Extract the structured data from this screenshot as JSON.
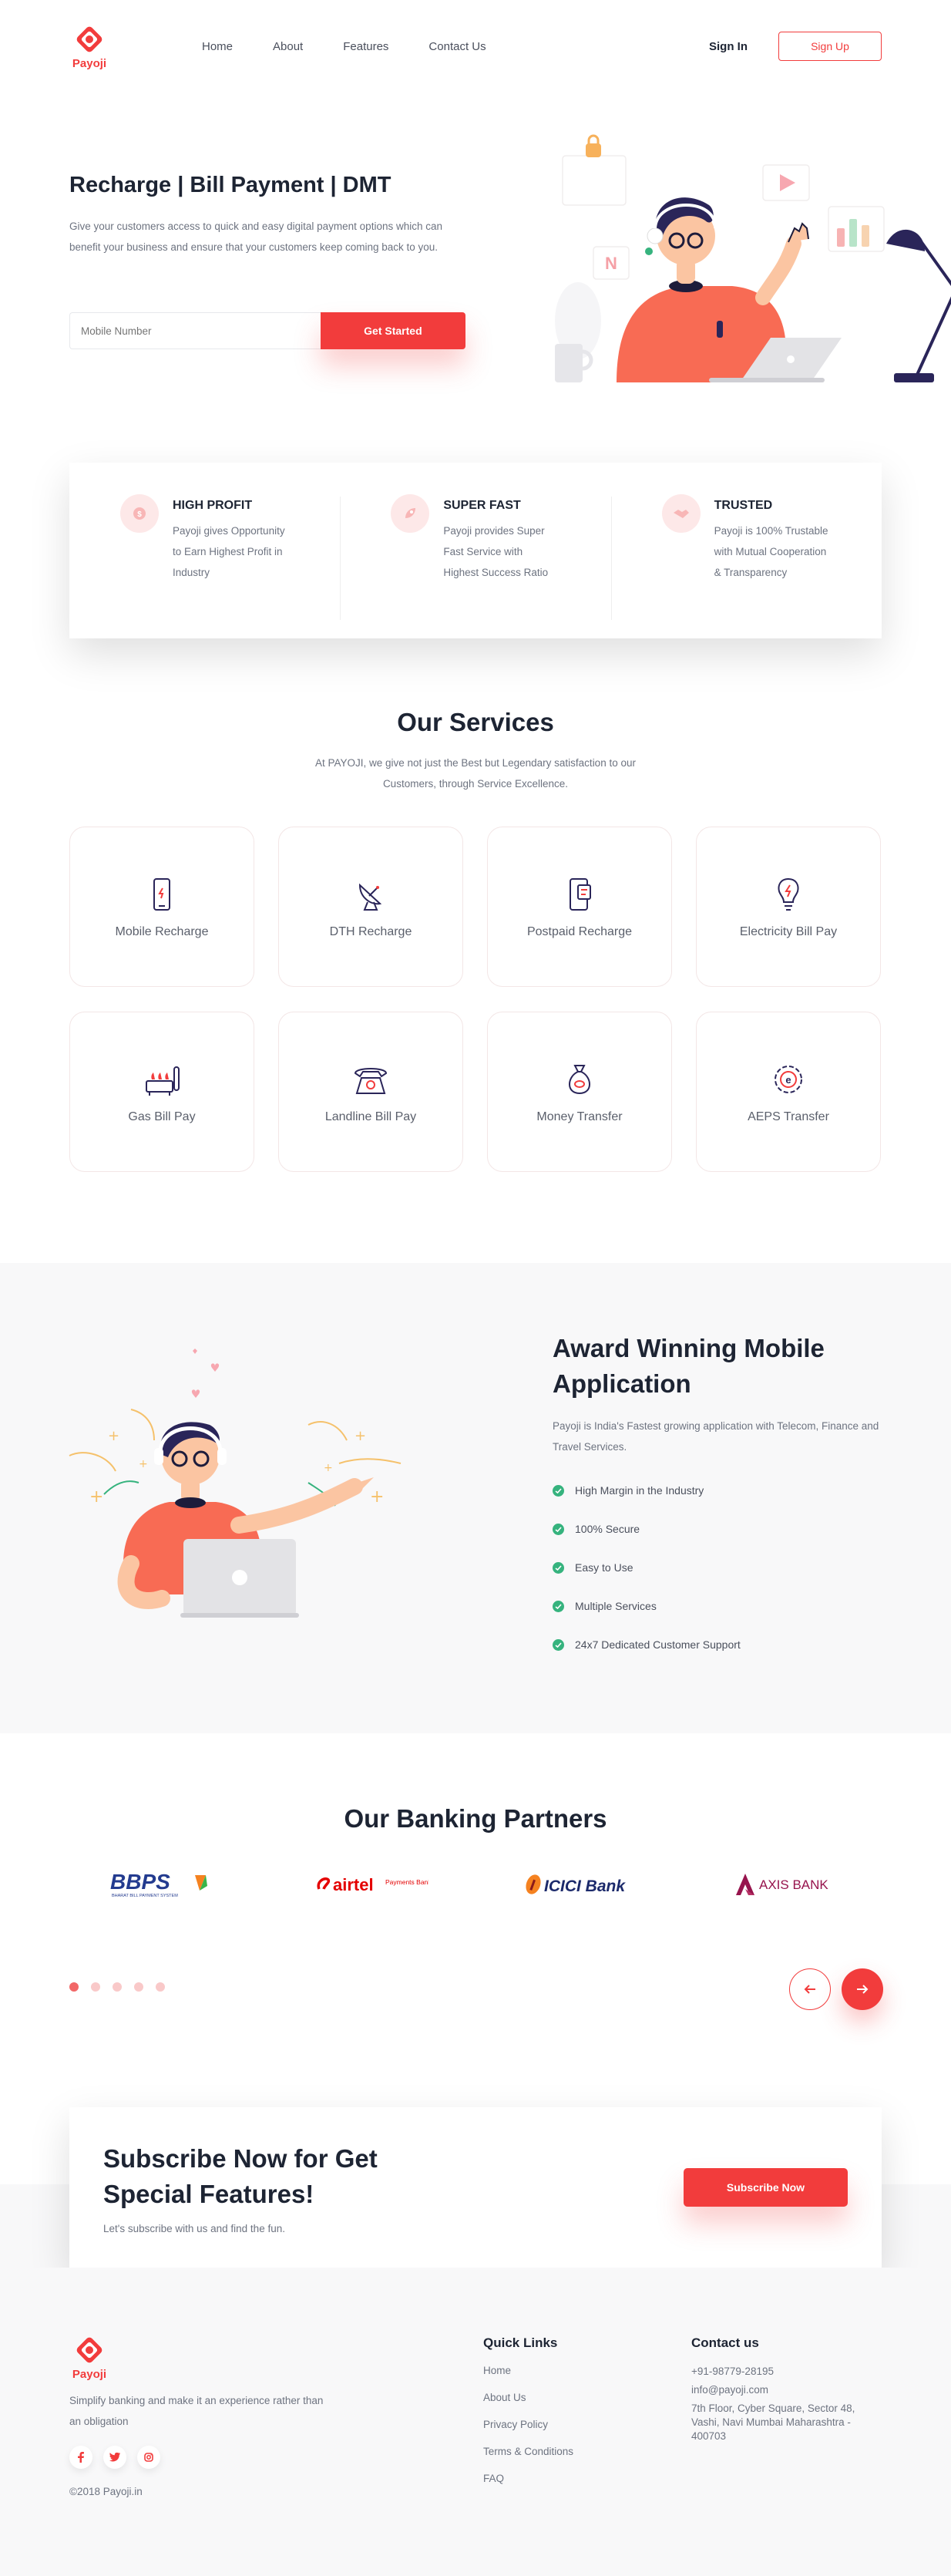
{
  "brand": {
    "name": "Payoji",
    "accent": "#f23c3c",
    "dark": "#1d2433",
    "muted": "#6d7380",
    "success": "#36b37e"
  },
  "nav": {
    "items": [
      "Home",
      "About",
      "Features",
      "Contact Us"
    ],
    "signin": "Sign In",
    "signup": "Sign Up"
  },
  "hero": {
    "title": "Recharge | Bill Payment | DMT",
    "description": "Give your customers access to quick and easy digital payment options which can benefit your business and ensure that your customers keep coming back to you.",
    "input_placeholder": "Mobile Number",
    "cta": "Get Started"
  },
  "features": [
    {
      "title": "HIGH PROFIT",
      "text": "Payoji gives Opportunity to Earn Highest Profit in Industry",
      "icon": "coin-icon"
    },
    {
      "title": "SUPER FAST",
      "text": "Payoji provides Super Fast Service with Highest Success Ratio",
      "icon": "rocket-icon"
    },
    {
      "title": "TRUSTED",
      "text": "Payoji is 100% Trustable with Mutual Cooperation & Transparency",
      "icon": "handshake-icon"
    }
  ],
  "services": {
    "title": "Our Services",
    "subtitle": "At PAYOJI, we give not just the Best but Legendary satisfaction to our Customers, through Service Excellence.",
    "items": [
      {
        "label": "Mobile Recharge",
        "icon": "mobile-icon"
      },
      {
        "label": "DTH Recharge",
        "icon": "satellite-dish-icon"
      },
      {
        "label": "Postpaid Recharge",
        "icon": "postpaid-phone-icon"
      },
      {
        "label": "Electricity Bill Pay",
        "icon": "bulb-icon"
      },
      {
        "label": "Gas Bill Pay",
        "icon": "gas-stove-icon"
      },
      {
        "label": "Landline Bill Pay",
        "icon": "telephone-icon"
      },
      {
        "label": "Money Transfer",
        "icon": "money-bag-icon"
      },
      {
        "label": "AEPS Transfer",
        "icon": "aeps-icon"
      }
    ]
  },
  "award": {
    "title": "Award Winning Mobile Application",
    "description": "Payoji is India's Fastest growing application with Telecom, Finance and Travel Services.",
    "points": [
      "High Margin in the Industry",
      "100% Secure",
      "Easy to Use",
      "Multiple Services",
      "24x7 Dedicated Customer Support"
    ]
  },
  "partners": {
    "title": "Our Banking Partners",
    "logos": [
      {
        "name": "BBPS",
        "sub": "BHARAT BILL PAYMENT SYSTEM"
      },
      {
        "name": "airtel",
        "sub": "Payments Bank"
      },
      {
        "name": "ICICI Bank"
      },
      {
        "name": "AXIS BANK"
      }
    ],
    "slider": {
      "count": 5,
      "active": 0
    }
  },
  "subscribe": {
    "title": "Subscribe Now for Get Special Features!",
    "subtitle": "Let's subscribe with us and find the fun.",
    "cta": "Subscribe Now"
  },
  "footer": {
    "tagline": "Simplify banking and make it an experience rather than an obligation",
    "copyright": "©2018 Payoji.in",
    "quick_links_title": "Quick Links",
    "quick_links": [
      "Home",
      "About Us",
      "Privacy Policy",
      "Terms & Conditions",
      "FAQ"
    ],
    "contact_title": "Contact us",
    "phone": "+91-98779-28195",
    "email": "info@payoji.com",
    "address": "7th Floor, Cyber Square, Sector 48, Vashi, Navi Mumbai Maharashtra - 400703",
    "social": [
      "facebook-icon",
      "twitter-icon",
      "instagram-icon"
    ]
  }
}
